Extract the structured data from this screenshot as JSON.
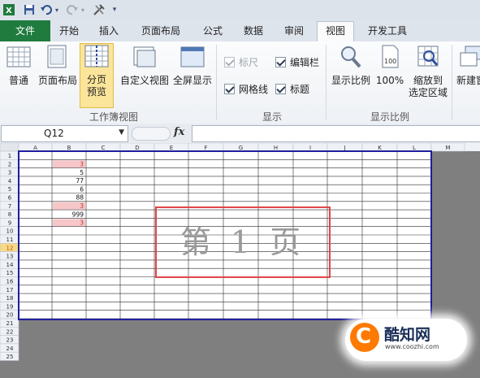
{
  "qat": {
    "icons": [
      "excel-logo-icon",
      "save-icon",
      "undo-icon",
      "undo-dropdown-icon",
      "redo-icon",
      "redo-dropdown-icon",
      "tools-icon",
      "customize-qat-icon"
    ]
  },
  "tabs": [
    {
      "label": "文件",
      "kind": "file"
    },
    {
      "label": "开始"
    },
    {
      "label": "插入"
    },
    {
      "label": "页面布局"
    },
    {
      "label": "公式"
    },
    {
      "label": "数据"
    },
    {
      "label": "审阅"
    },
    {
      "label": "视图",
      "active": true
    },
    {
      "label": "开发工具"
    }
  ],
  "ribbon": {
    "workbook_views": {
      "group_label": "工作簿视图",
      "normal": "普通",
      "page_layout": "页面布局",
      "page_break_line1": "分页",
      "page_break_line2": "预览",
      "custom_views": "自定义视图",
      "full_screen": "全屏显示"
    },
    "show": {
      "group_label": "显示",
      "ruler": "标尺",
      "formula_bar": "编辑栏",
      "gridlines": "网格线",
      "headings": "标题"
    },
    "zoom": {
      "group_label": "显示比例",
      "zoom": "显示比例",
      "hundred": "100%",
      "hundred_icon_text": "100",
      "zoom_sel_line1": "缩放到",
      "zoom_sel_line2": "选定区域"
    },
    "window": {
      "new_window": "新建窗"
    }
  },
  "formula_bar": {
    "name_box": "Q12",
    "fx": "fx",
    "value": ""
  },
  "sheet": {
    "columns": [
      "A",
      "B",
      "C",
      "D",
      "E",
      "F",
      "G",
      "H",
      "I",
      "J",
      "K",
      "L",
      "M"
    ],
    "rows": [
      "1",
      "2",
      "3",
      "4",
      "5",
      "6",
      "7",
      "8",
      "9",
      "10",
      "11",
      "12",
      "13",
      "14",
      "15",
      "16",
      "17",
      "18",
      "19",
      "20",
      "21",
      "22",
      "23",
      "24",
      "25"
    ],
    "cells": [
      {
        "row": 2,
        "col": "B",
        "value": "3",
        "highlight": true
      },
      {
        "row": 3,
        "col": "B",
        "value": "5"
      },
      {
        "row": 4,
        "col": "B",
        "value": "77"
      },
      {
        "row": 5,
        "col": "B",
        "value": "6"
      },
      {
        "row": 6,
        "col": "B",
        "value": "88"
      },
      {
        "row": 7,
        "col": "B",
        "value": "3",
        "highlight": true
      },
      {
        "row": 8,
        "col": "B",
        "value": "999"
      },
      {
        "row": 9,
        "col": "B",
        "value": "3",
        "highlight": true
      }
    ],
    "selected_row": "12",
    "page_label": "第 1 页",
    "colors": {
      "highlight": "#f7c6c9",
      "page_border": "#1f1f9c",
      "annotation": "#e0464b"
    }
  },
  "watermark": {
    "brand": "酷知网",
    "url": "www.coozhi.com"
  }
}
